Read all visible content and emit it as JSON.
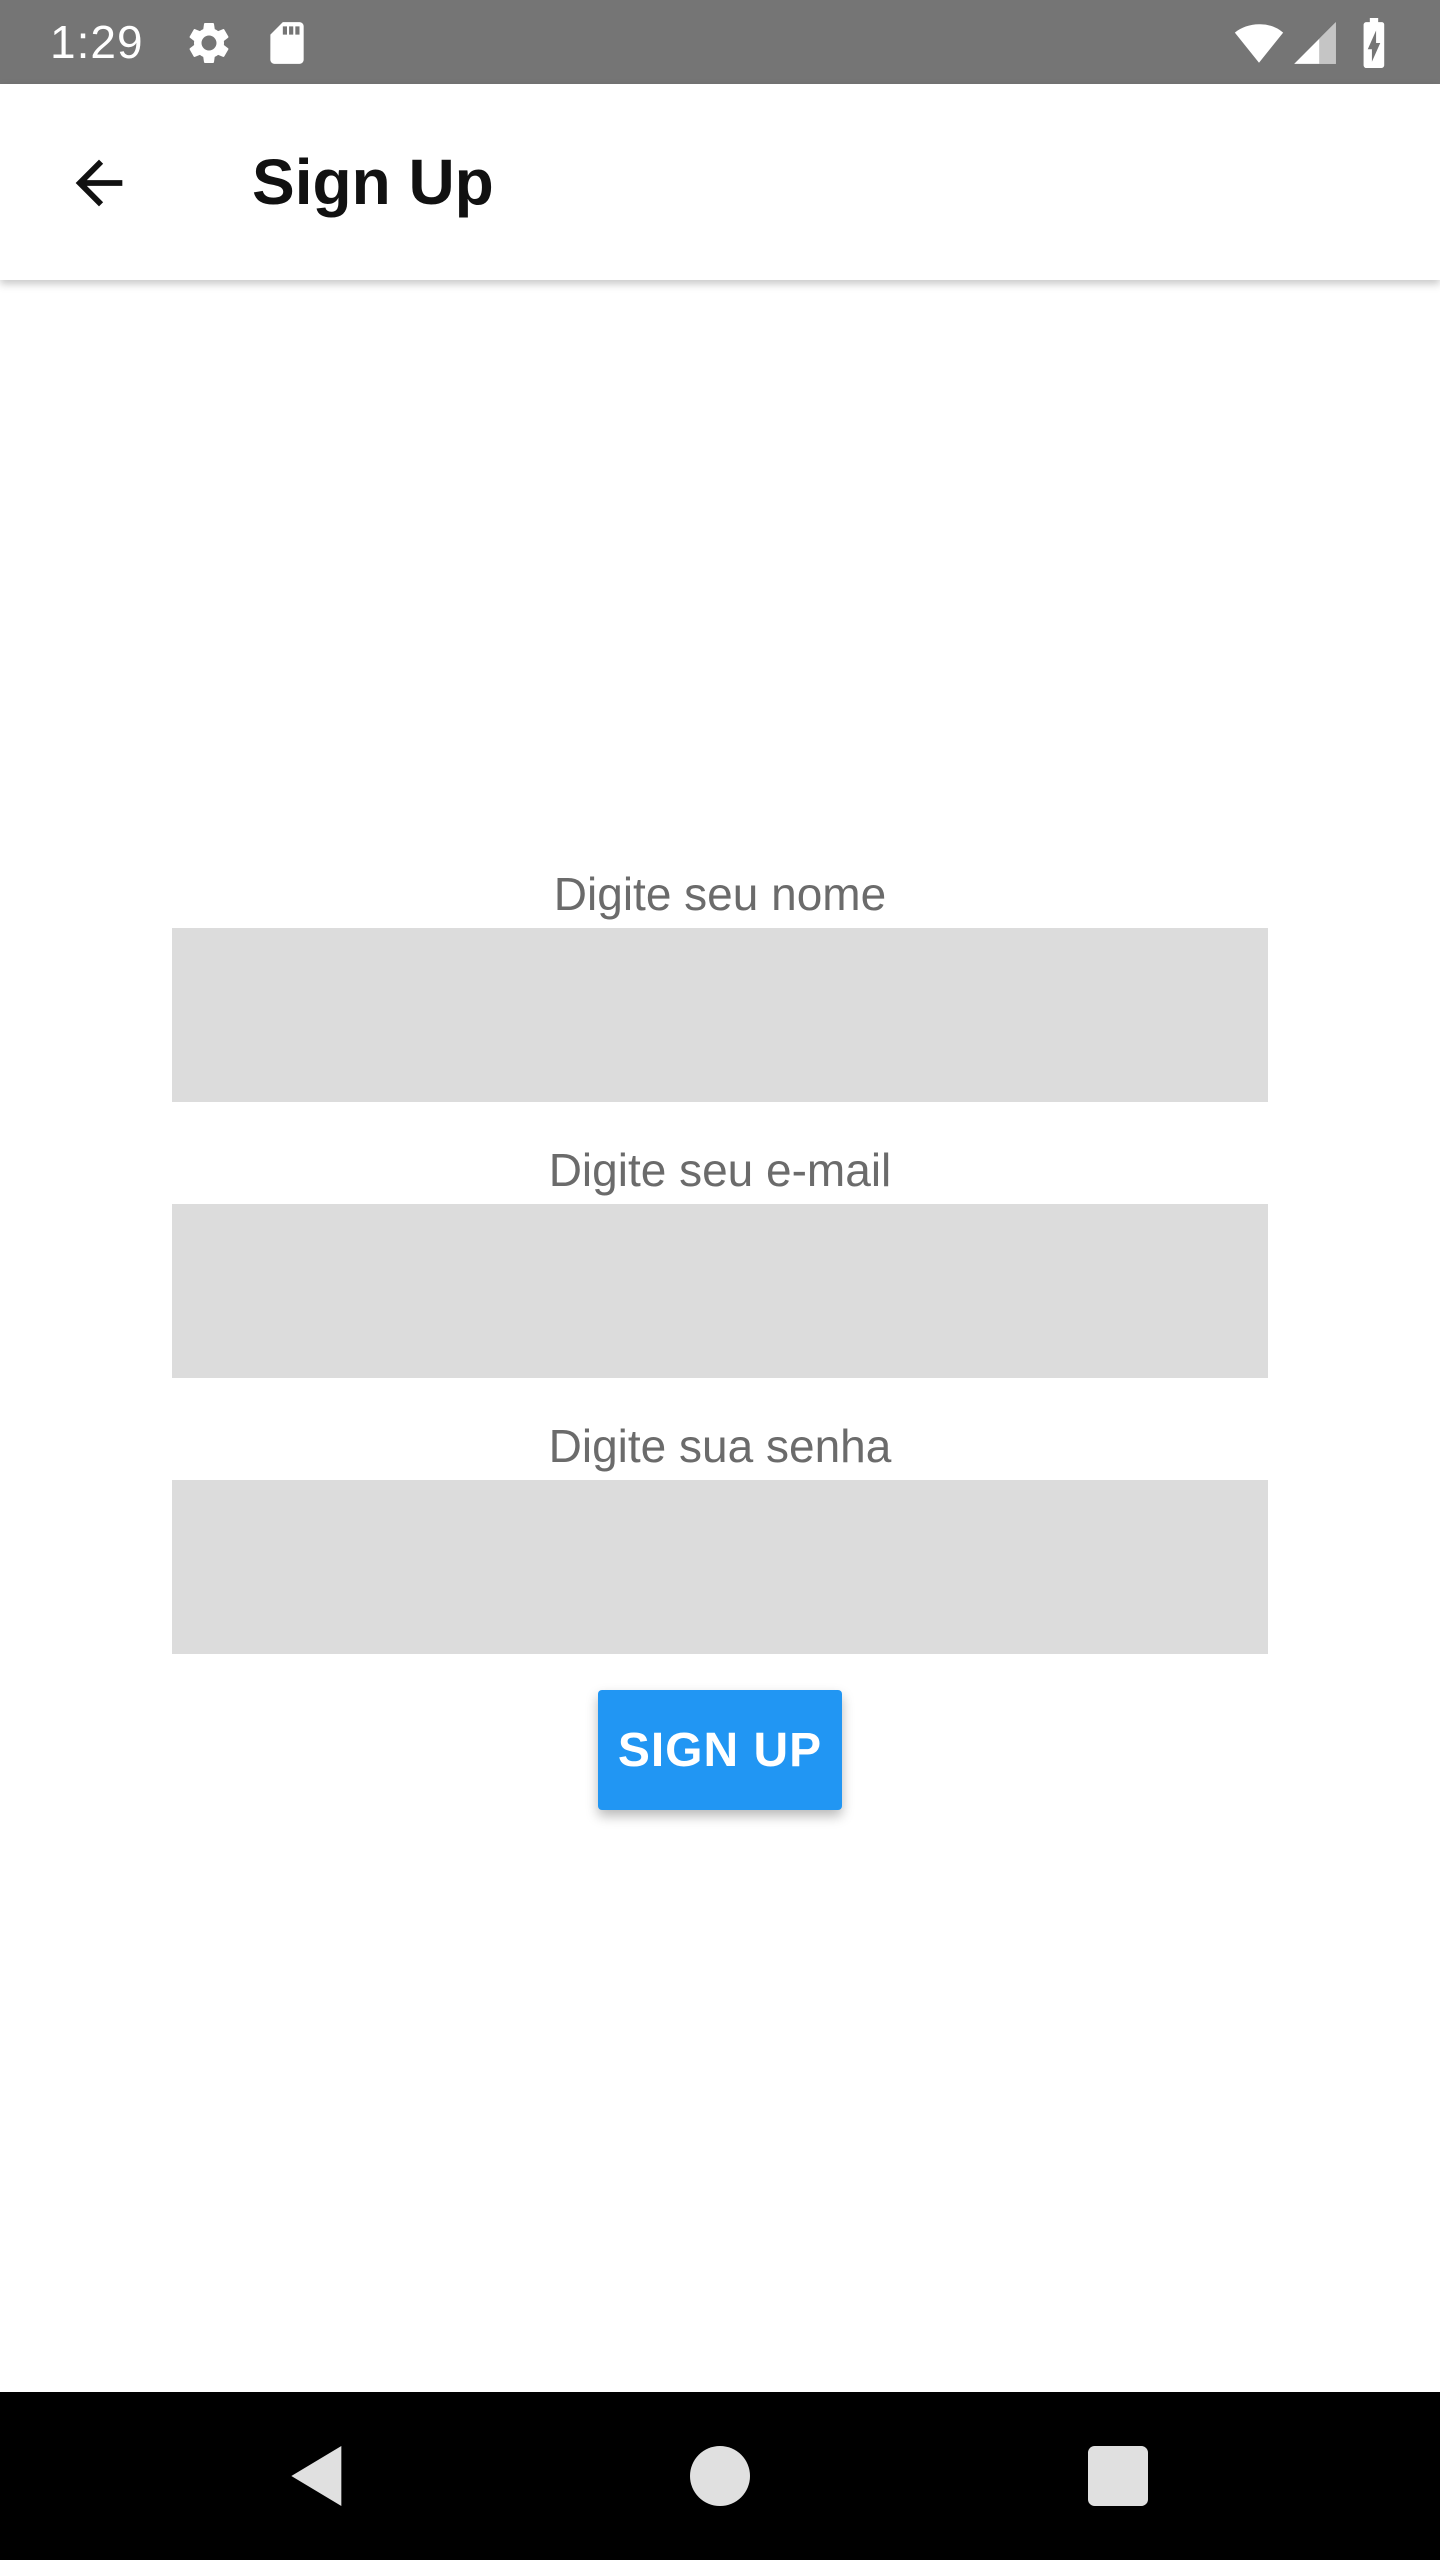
{
  "status_bar": {
    "time": "1:29",
    "icons": [
      "settings-icon",
      "sd-card-icon",
      "wifi-icon",
      "signal-icon",
      "battery-charging-icon"
    ],
    "background": "#757575"
  },
  "app_bar": {
    "title": "Sign Up",
    "back_icon": "arrow-back-icon"
  },
  "form": {
    "name_label": "Digite seu nome",
    "name_value": "",
    "email_label": "Digite seu e-mail",
    "email_value": "",
    "password_label": "Digite sua senha",
    "password_value": "",
    "field_background": "#dcdcdc",
    "label_color": "#6b6b6b"
  },
  "signup_button": {
    "label": "SIGN UP",
    "color": "#2196f3"
  },
  "nav_bar": {
    "icons": [
      "nav-back-icon",
      "nav-home-icon",
      "nav-recents-icon"
    ]
  }
}
